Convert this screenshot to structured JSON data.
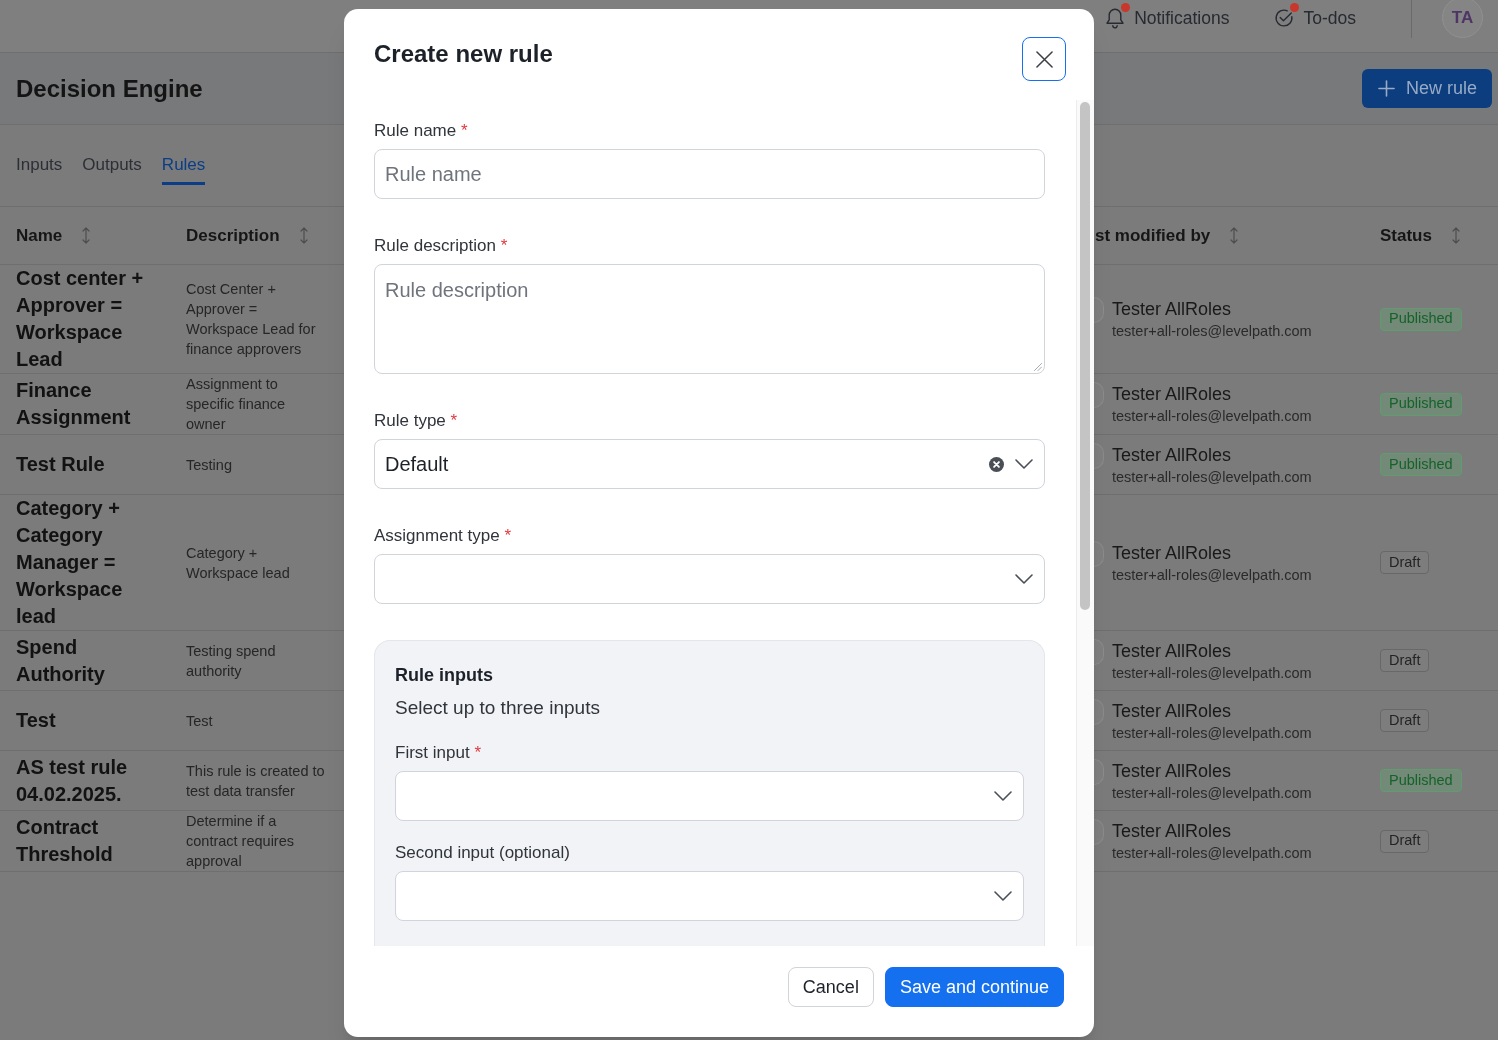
{
  "top_bar": {
    "notifications": {
      "label": "Notifications",
      "unread": true
    },
    "todos": {
      "label": "To-dos",
      "unread": true
    },
    "avatar": {
      "initials": "TA"
    }
  },
  "page_header": {
    "title": "Decision Engine",
    "new_rule_button": {
      "label": "New rule"
    }
  },
  "tabs": [
    {
      "label": "Inputs",
      "selected": false
    },
    {
      "label": "Outputs",
      "selected": false
    },
    {
      "label": "Rules",
      "selected": true
    }
  ],
  "table": {
    "columns": [
      {
        "label": "Name"
      },
      {
        "label": "Description"
      },
      {
        "label": "st modified by"
      },
      {
        "label": "Status"
      }
    ],
    "rows": [
      {
        "name": "Cost center + Approver = Workspace Lead",
        "description": "Cost Center + Approver = Workspace Lead for finance approvers",
        "modified_by": {
          "name": "Tester AllRoles",
          "email": "tester+all-roles@levelpath.com"
        },
        "status": {
          "label": "Published",
          "kind": "published"
        }
      },
      {
        "name": "Finance Assignment",
        "description": "Assignment to specific finance owner",
        "modified_by": {
          "name": "Tester AllRoles",
          "email": "tester+all-roles@levelpath.com"
        },
        "status": {
          "label": "Published",
          "kind": "published"
        }
      },
      {
        "name": "Test Rule",
        "description": "Testing",
        "modified_by": {
          "name": "Tester AllRoles",
          "email": "tester+all-roles@levelpath.com"
        },
        "status": {
          "label": "Published",
          "kind": "published"
        }
      },
      {
        "name": "Category + Category Manager = Workspace lead",
        "description": "Category + Workspace lead",
        "modified_by": {
          "name": "Tester AllRoles",
          "email": "tester+all-roles@levelpath.com"
        },
        "status": {
          "label": "Draft",
          "kind": "draft"
        }
      },
      {
        "name": "Spend Authority",
        "description": "Testing spend authority",
        "modified_by": {
          "name": "Tester AllRoles",
          "email": "tester+all-roles@levelpath.com"
        },
        "status": {
          "label": "Draft",
          "kind": "draft"
        }
      },
      {
        "name": "Test",
        "description": "Test",
        "modified_by": {
          "name": "Tester AllRoles",
          "email": "tester+all-roles@levelpath.com"
        },
        "status": {
          "label": "Draft",
          "kind": "draft"
        }
      },
      {
        "name": "AS test rule 04.02.2025.",
        "description": "This rule is created to test data transfer",
        "modified_by": {
          "name": "Tester AllRoles",
          "email": "tester+all-roles@levelpath.com"
        },
        "status": {
          "label": "Published",
          "kind": "published"
        }
      },
      {
        "name": "Contract Threshold",
        "description": "Determine if a contract requires approval",
        "modified_by": {
          "name": "Tester AllRoles",
          "email": "tester+all-roles@levelpath.com"
        },
        "status": {
          "label": "Draft",
          "kind": "draft"
        }
      }
    ]
  },
  "modal": {
    "title": "Create new rule",
    "close_button": {
      "focused": true
    },
    "fields": [
      {
        "kind": "text",
        "label": "Rule name",
        "required_mark": "*",
        "placeholder": "Rule name"
      },
      {
        "kind": "textarea",
        "label": "Rule description",
        "required_mark": "*",
        "placeholder": "Rule description"
      },
      {
        "kind": "select",
        "label": "Rule type",
        "required_mark": "*",
        "value": "Default"
      },
      {
        "kind": "select",
        "label": "Assignment type",
        "required_mark": "*"
      }
    ],
    "rule_inputs": {
      "title": "Rule inputs",
      "subtitle": "Select up to three inputs",
      "fields": [
        {
          "kind": "select",
          "label": "First input",
          "required_mark": "*"
        },
        {
          "kind": "select",
          "label": "Second input (optional)"
        }
      ]
    },
    "buttons": [
      {
        "label": "Cancel",
        "kind": "secondary"
      },
      {
        "label": "Save and continue",
        "kind": "primary"
      }
    ]
  }
}
